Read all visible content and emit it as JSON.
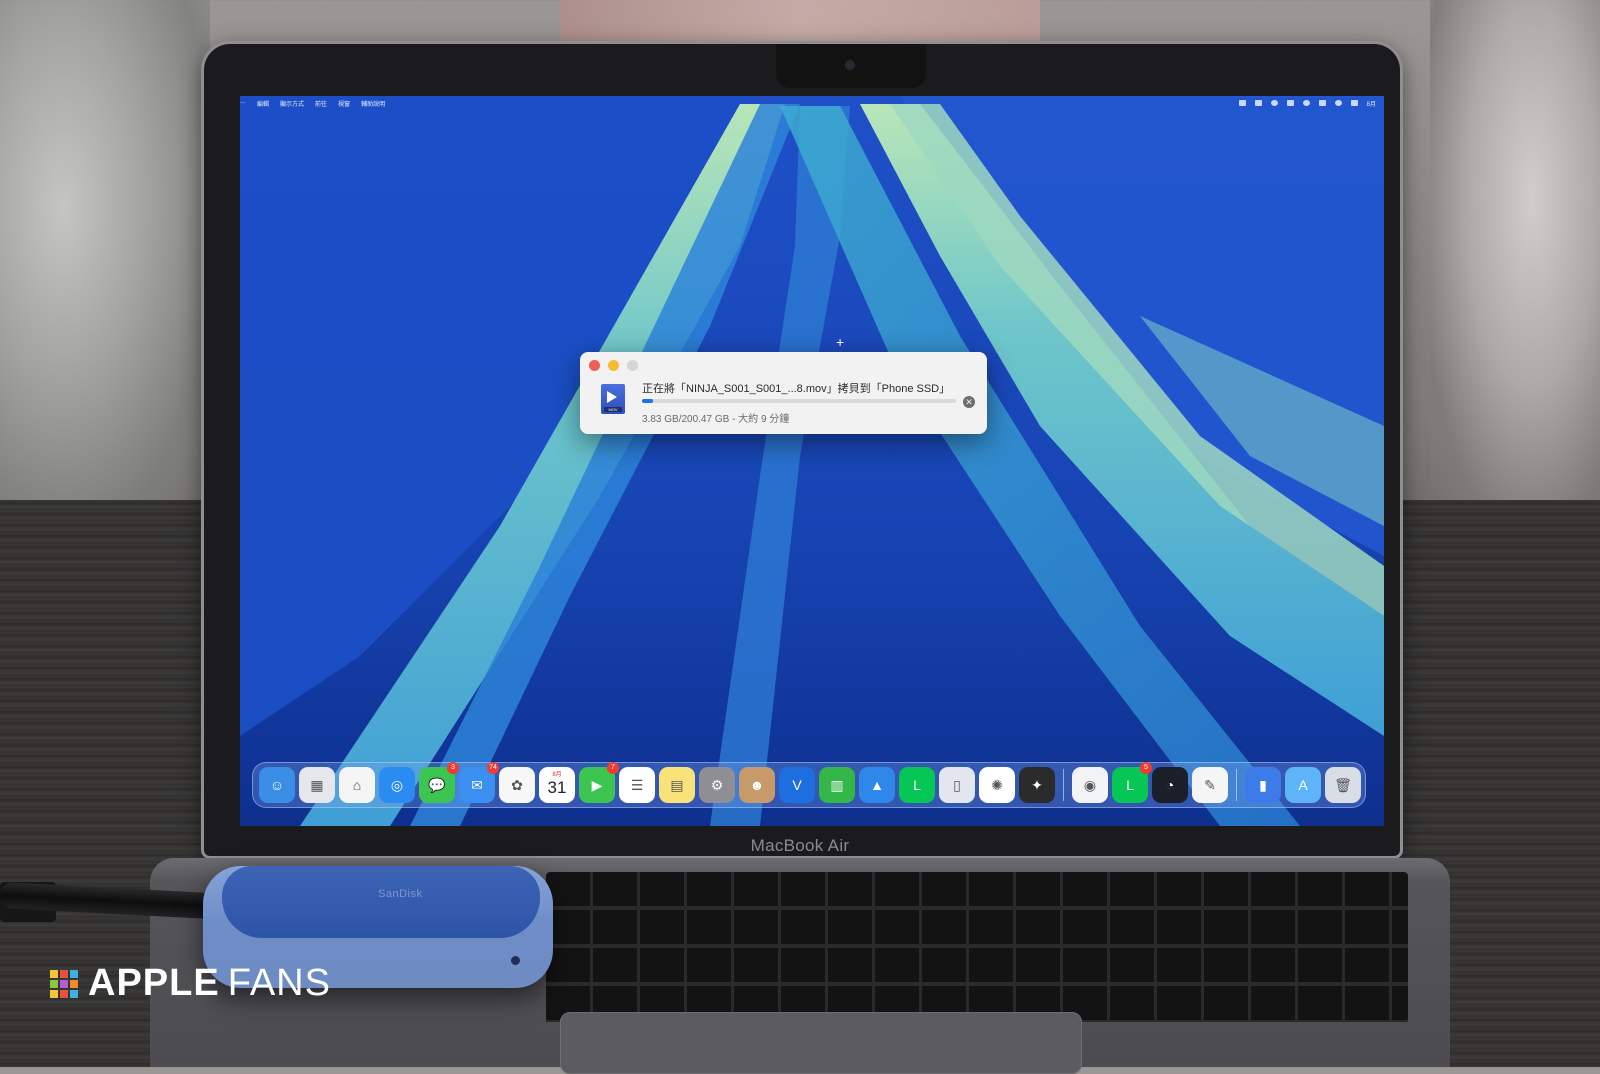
{
  "laptop": {
    "brand_label": "MacBook Air"
  },
  "menubar": {
    "items": [
      "…",
      "編輯",
      "顯示方式",
      "前往",
      "視窗",
      "輔助說明"
    ],
    "status_icons": [
      "ellipsis-icon",
      "app-icon",
      "shield-icon",
      "music-icon",
      "bluetooth-icon",
      "volume-icon",
      "wifi-icon",
      "control-center-icon"
    ],
    "clock": "8月"
  },
  "copy_dialog": {
    "message": "正在將「NINJA_S001_S001_...8.mov」拷貝到「Phone SSD」",
    "status": "3.83 GB/200.47 GB - 大約 9 分鐘",
    "progress_percent": 1.9,
    "file_badge": "MOV",
    "cancel_glyph": "✕"
  },
  "dock": {
    "apps": [
      {
        "name": "finder-icon",
        "color": "#3a8ee6",
        "glyph": "☺"
      },
      {
        "name": "launchpad-icon",
        "color": "#e6e7ec",
        "glyph": "▦"
      },
      {
        "name": "home-icon",
        "color": "#f5f5f5",
        "glyph": "⌂"
      },
      {
        "name": "safari-icon",
        "color": "#2a8cf0",
        "glyph": "◎"
      },
      {
        "name": "messages-icon",
        "color": "#3cc651",
        "glyph": "💬",
        "badge": "3"
      },
      {
        "name": "mail-icon",
        "color": "#3a8ff0",
        "glyph": "✉",
        "badge": "74"
      },
      {
        "name": "photos-icon",
        "color": "#f7f7f7",
        "glyph": "✿"
      },
      {
        "name": "calendar-icon",
        "color": "#ffffff",
        "month": "8月",
        "day": "31"
      },
      {
        "name": "facetime-icon",
        "color": "#3cc651",
        "glyph": "▶",
        "badge": "7"
      },
      {
        "name": "reminders-icon",
        "color": "#ffffff",
        "glyph": "☰"
      },
      {
        "name": "notes-icon",
        "color": "#f9e27a",
        "glyph": "▤"
      },
      {
        "name": "settings-icon",
        "color": "#8e8e93",
        "glyph": "⚙"
      },
      {
        "name": "contacts-icon",
        "color": "#c79a6a",
        "glyph": "☻"
      },
      {
        "name": "vpn-icon",
        "color": "#1d6fe0",
        "glyph": "V"
      },
      {
        "name": "numbers-icon",
        "color": "#35b649",
        "glyph": "▥"
      },
      {
        "name": "keynote-icon",
        "color": "#2f87ea",
        "glyph": "▲"
      },
      {
        "name": "line-icon",
        "color": "#06c755",
        "glyph": "L"
      },
      {
        "name": "iphone-mirroring-icon",
        "color": "#e4e6ef",
        "glyph": "▯"
      },
      {
        "name": "chatgpt-icon",
        "color": "#ffffff",
        "glyph": "✺"
      },
      {
        "name": "tes-icon",
        "color": "#2b2b2b",
        "glyph": "✦"
      }
    ],
    "recent_apps": [
      {
        "name": "chrome-icon",
        "color": "#f1f3f4",
        "glyph": "◉"
      },
      {
        "name": "line-icon",
        "color": "#06c755",
        "glyph": "L",
        "badge": "5"
      },
      {
        "name": "gauge-icon",
        "color": "#1b1f2a",
        "glyph": "◔"
      },
      {
        "name": "textedit-icon",
        "color": "#f5f5f5",
        "glyph": "✎"
      }
    ],
    "folders": [
      {
        "name": "ssd-folder-icon",
        "color": "#3d7be8",
        "glyph": "▮"
      },
      {
        "name": "applications-folder-icon",
        "color": "#5eb4f6",
        "glyph": "A"
      },
      {
        "name": "trash-icon",
        "color": "#d9dde6",
        "glyph": "🗑"
      }
    ]
  },
  "ssd": {
    "label": "SanDisk"
  },
  "watermark": {
    "word1": "APPLE",
    "word2": "FANS",
    "colors": [
      "#f2c53d",
      "#e5533d",
      "#3db0e5",
      "#8ac640",
      "#b65ad6",
      "#f08a2c"
    ]
  }
}
